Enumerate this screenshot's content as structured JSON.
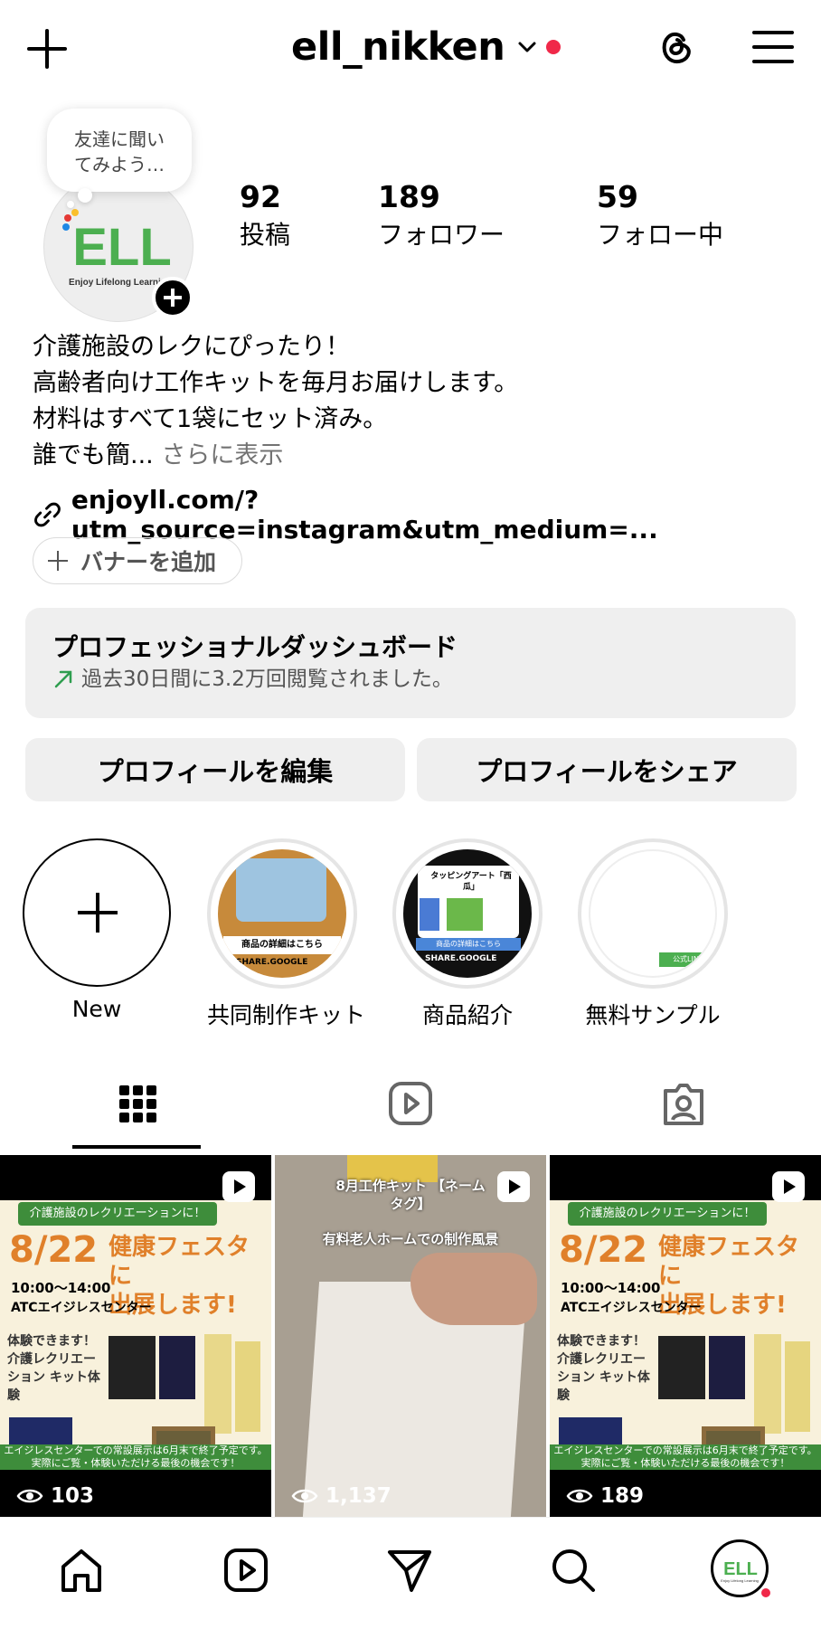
{
  "header": {
    "username": "ell_nikken",
    "notification_color": "#f02849"
  },
  "profile": {
    "note": "友達に聞い てみよう…",
    "avatar_logo": "ELL",
    "avatar_tagline": "Enjoy Lifelong Learning",
    "stats": [
      {
        "value": "92",
        "label": "投稿"
      },
      {
        "value": "189",
        "label": "フォロワー"
      },
      {
        "value": "59",
        "label": "フォロー中"
      }
    ],
    "bio_lines": [
      "介護施設のレクにぴったり！",
      "高齢者向け工作キットを毎月お届けします。",
      "材料はすべて1袋にセット済み。",
      "誰でも簡..."
    ],
    "bio_more": "さらに表示",
    "link": "enjoyll.com/?utm_source=instagram&utm_medium=...",
    "banner_button": "バナーを追加"
  },
  "dashboard": {
    "title": "プロフェッショナルダッシュボード",
    "subtitle": "過去30日間に3.2万回閲覧されました。"
  },
  "actions": {
    "edit": "プロフィールを編集",
    "share": "プロフィールをシェア"
  },
  "highlights": [
    {
      "label": "New"
    },
    {
      "label": "共同制作キット"
    },
    {
      "label": "商品紹介"
    },
    {
      "label": "無料サンプル"
    }
  ],
  "tabs": [
    "grid-icon",
    "reels-icon",
    "tagged-icon"
  ],
  "posts": [
    {
      "views": "103",
      "header": "介護施設のレクリエーションに！",
      "date": "8/22",
      "title_lines": [
        "健康フェスタに",
        "出展します!"
      ],
      "time": "10:00～14:00",
      "location": "ATCエイジレスセンター",
      "experience": "体験できます！ 介護レクリエーション キット体験",
      "footer": "エイジレスセンターでの常設展示は6月末で終了予定です。 実際にご覧・体験いただける最後の機会です！"
    },
    {
      "views": "1,137",
      "caption1": "8月工作キット 【ネームタグ】",
      "caption2": "有料老人ホームでの制作風景"
    },
    {
      "views": "189",
      "header": "介護施設のレクリエーションに！",
      "date": "8/22",
      "title_lines": [
        "健康フェスタに",
        "出展します!"
      ],
      "time": "10:00～14:00",
      "location": "ATCエイジレスセンター",
      "experience": "体験できます！ 介護レクリエーション キット体験",
      "footer": "エイジレスセンターでの常設展示は6月末で終了予定です。 実際にご覧・体験いただける最後の機会です！"
    }
  ],
  "highlight_images": {
    "kit_caption": "商品の詳細はこちら",
    "kit_url": "SHARE.GOOGLE",
    "product_title": "タッピングアート「西瓜」",
    "product_caption": "商品の詳細はこちら",
    "product_url": "SHARE.GOOGLE",
    "sample_caption": "公式LINE"
  },
  "bottom_nav": [
    "home-icon",
    "reels-icon",
    "direct-icon",
    "search-icon",
    "profile-avatar"
  ],
  "nav_avatar_logo": "ELL",
  "nav_avatar_tagline": "Enjoy Lifelong Learning"
}
